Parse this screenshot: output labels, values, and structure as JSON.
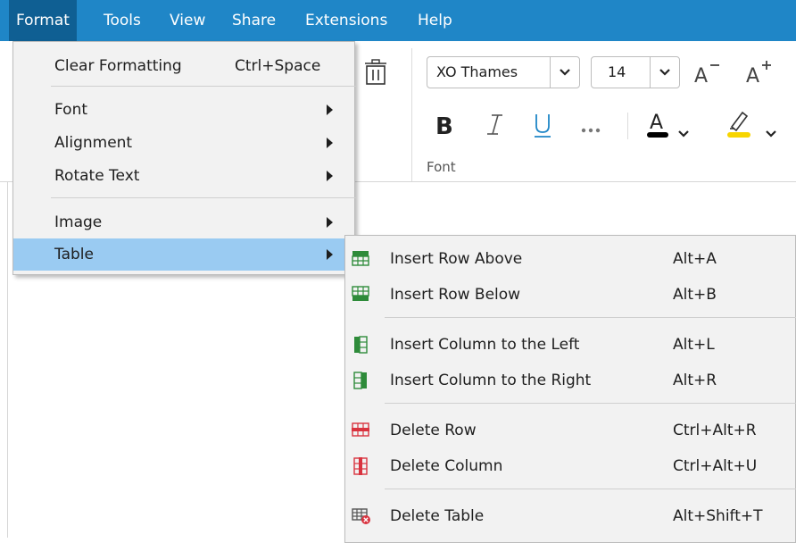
{
  "menubar": {
    "items": [
      {
        "label": "Format",
        "active": true
      },
      {
        "label": "Tools"
      },
      {
        "label": "View"
      },
      {
        "label": "Share"
      },
      {
        "label": "Extensions"
      },
      {
        "label": "Help"
      }
    ]
  },
  "ribbon": {
    "font_name": "XO Thames",
    "font_size": "14",
    "font_group_label": "Font",
    "text_color_letter": "A",
    "highlight_color_hex": "#f7d500",
    "text_color_hex": "#000000"
  },
  "format_menu": {
    "items": [
      {
        "label": "Clear Formatting",
        "shortcut": "Ctrl+Space"
      },
      {
        "label": "Font",
        "submenu": true
      },
      {
        "label": "Alignment",
        "submenu": true
      },
      {
        "label": "Rotate Text",
        "submenu": true
      },
      {
        "label": "Image",
        "submenu": true
      },
      {
        "label": "Table",
        "submenu": true,
        "highlighted": true
      }
    ]
  },
  "table_menu": {
    "items": [
      {
        "label": "Insert Row Above",
        "shortcut": "Alt+A",
        "icon": "insert-row-above-icon"
      },
      {
        "label": "Insert Row Below",
        "shortcut": "Alt+B",
        "icon": "insert-row-below-icon"
      },
      {
        "label": "Insert Column to the Left",
        "shortcut": "Alt+L",
        "icon": "insert-column-left-icon"
      },
      {
        "label": "Insert Column to the Right",
        "shortcut": "Alt+R",
        "icon": "insert-column-right-icon"
      },
      {
        "label": "Delete Row",
        "shortcut": "Ctrl+Alt+R",
        "icon": "delete-row-icon"
      },
      {
        "label": "Delete Column",
        "shortcut": "Ctrl+Alt+U",
        "icon": "delete-column-icon"
      },
      {
        "label": "Delete Table",
        "shortcut": "Alt+Shift+T",
        "icon": "delete-table-icon"
      }
    ]
  },
  "colors": {
    "menubar_bg": "#1f86c7",
    "menubar_active": "#0f5f93",
    "menu_highlight": "#9acbf2",
    "icon_green": "#2e8b3a",
    "icon_red": "#d9333f"
  }
}
